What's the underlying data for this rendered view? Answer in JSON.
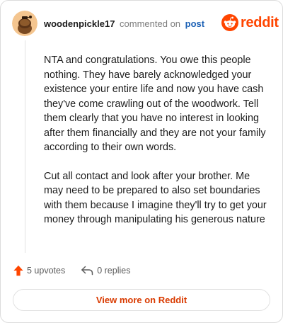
{
  "comment": {
    "username": "woodenpickle17",
    "action_text": "commented on",
    "post_link": "post",
    "paragraphs": [
      "NTA and congratulations. You owe this people nothing. They have barely acknowledged your existence your entire life and now you have cash they've come crawling out of the woodwork. Tell them clearly that you have no interest in looking after them financially and they are not your family according to their own words.",
      "Cut all contact and look after your brother. Me may need to be prepared to also set boundaries with them because I imagine they'll try to get your money through manipulating his generous nature"
    ]
  },
  "brand": {
    "wordmark": "reddit",
    "color": "#ff4500"
  },
  "actions": {
    "upvotes": "5 upvotes",
    "replies": "0 replies"
  },
  "footer": {
    "view_button": "View more on Reddit"
  },
  "icons": {
    "avatar": "snoo-avatar-icon",
    "upvote": "upvote-arrow-icon",
    "reply": "reply-arrow-icon",
    "brand": "reddit-snoo-icon"
  },
  "colors": {
    "accent": "#ff4500",
    "link": "#1c61b5",
    "text": "#1c1c1c",
    "muted": "#7c7c7c"
  }
}
